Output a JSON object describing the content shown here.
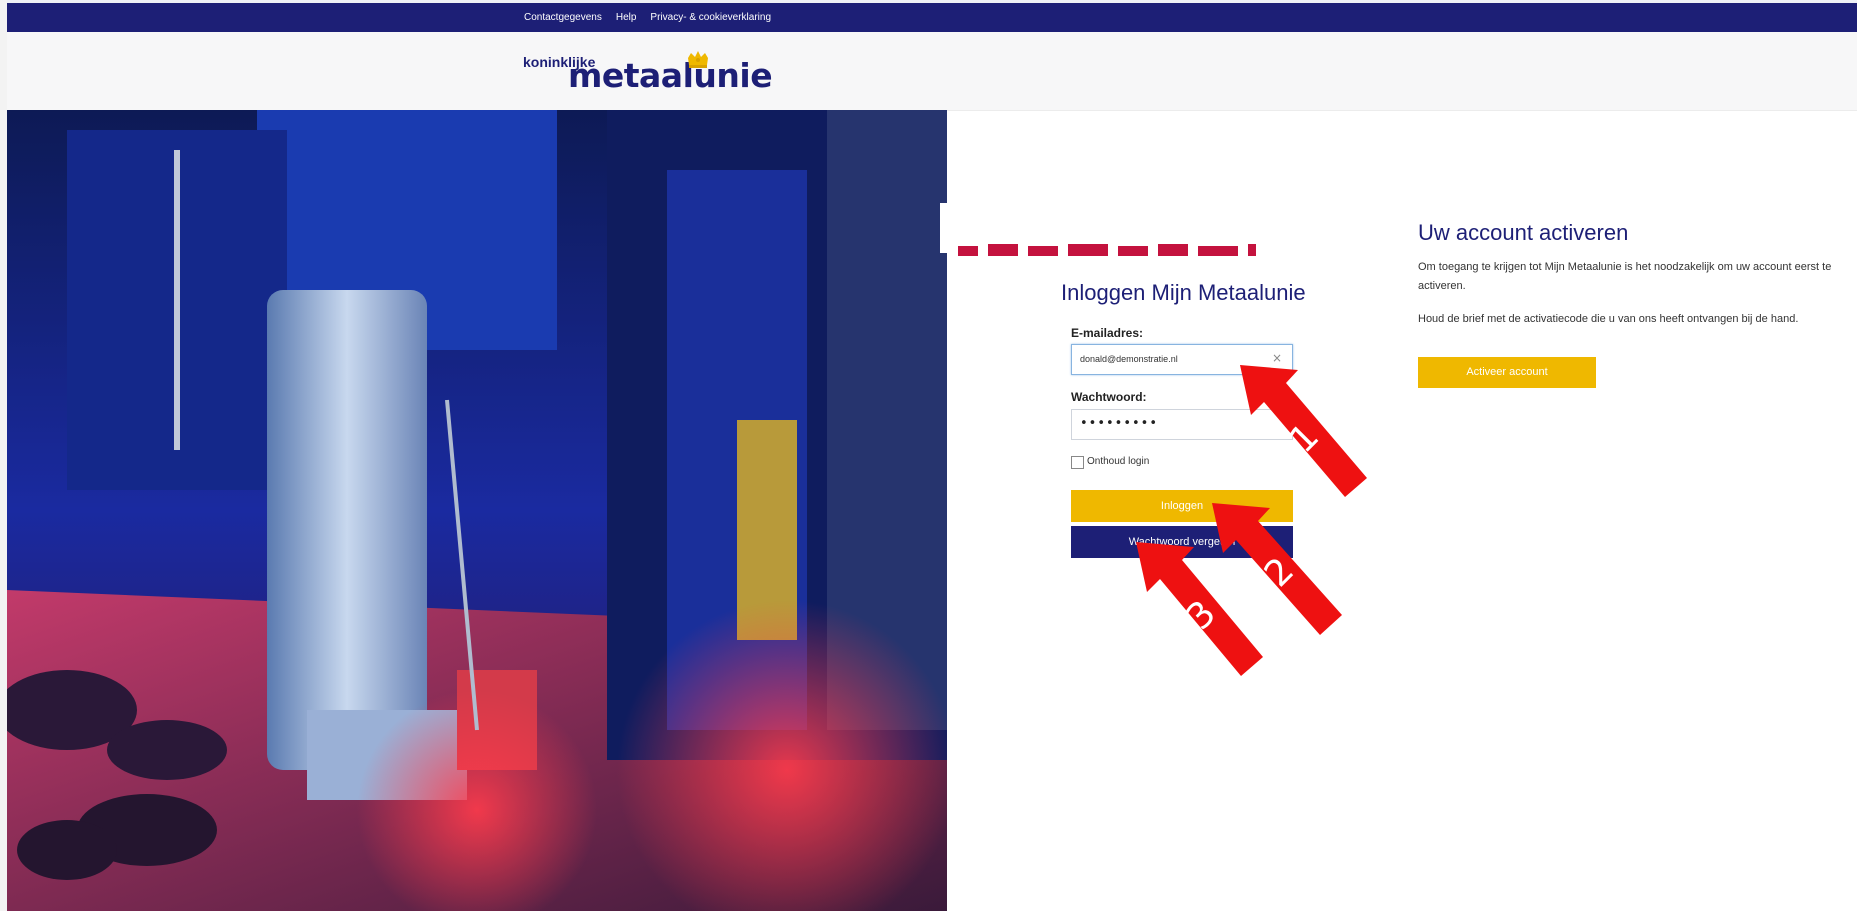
{
  "topbar": {
    "links": [
      "Contactgegevens",
      "Help",
      "Privacy- & cookieverklaring"
    ]
  },
  "logo": {
    "line1": "koninklijke",
    "line2": "metaalunie"
  },
  "login": {
    "title": "Inloggen Mijn Metaalunie",
    "email_label": "E-mailadres:",
    "email_value": "donald@demonstratie.nl",
    "clear_icon": "×",
    "password_label": "Wachtwoord:",
    "password_value": "•••••••••",
    "remember_label": "Onthoud login",
    "login_button": "Inloggen",
    "forgot_button": "Wachtwoord vergeten"
  },
  "activate": {
    "title": "Uw account activeren",
    "text": "Om toegang te krijgen tot Mijn Metaalunie is het noodzakelijk om uw account eerst te activeren.",
    "text2": "Houd de brief met de activatiecode die u van ons heeft ontvangen bij de hand.",
    "button": "Activeer account"
  },
  "annotations": {
    "arrow1": "1",
    "arrow2": "2",
    "arrow3": "3"
  },
  "colors": {
    "navy": "#1d1f76",
    "yellow": "#efb800",
    "arrow": "#ee1111"
  }
}
